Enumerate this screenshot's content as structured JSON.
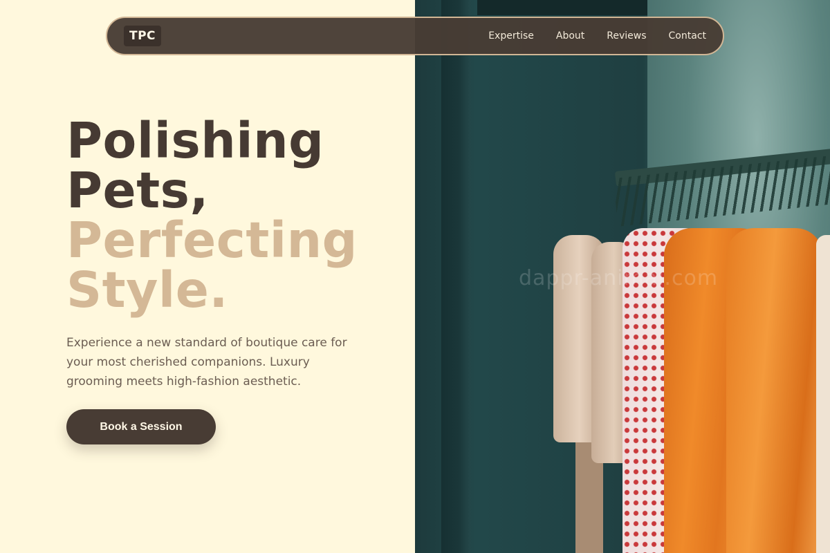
{
  "nav": {
    "logo": "TPC",
    "links": [
      "Expertise",
      "About",
      "Reviews",
      "Contact"
    ]
  },
  "hero": {
    "line1": "Polishing",
    "line2": "Pets,",
    "line3": "Perfecting",
    "line4": "Style.",
    "subtitle": "Experience a new standard of boutique care for your most cherished companions. Luxury grooming meets high-fashion aesthetic.",
    "cta_label": "Book a Session"
  },
  "image": {
    "watermark": "dappr-animal.com"
  },
  "colors": {
    "background": "#fff8dd",
    "nav_bg": "#483c34",
    "nav_border": "#d2b796",
    "heading_dark": "#463a33",
    "heading_accent": "#d4b896",
    "button_bg": "#483c34"
  }
}
